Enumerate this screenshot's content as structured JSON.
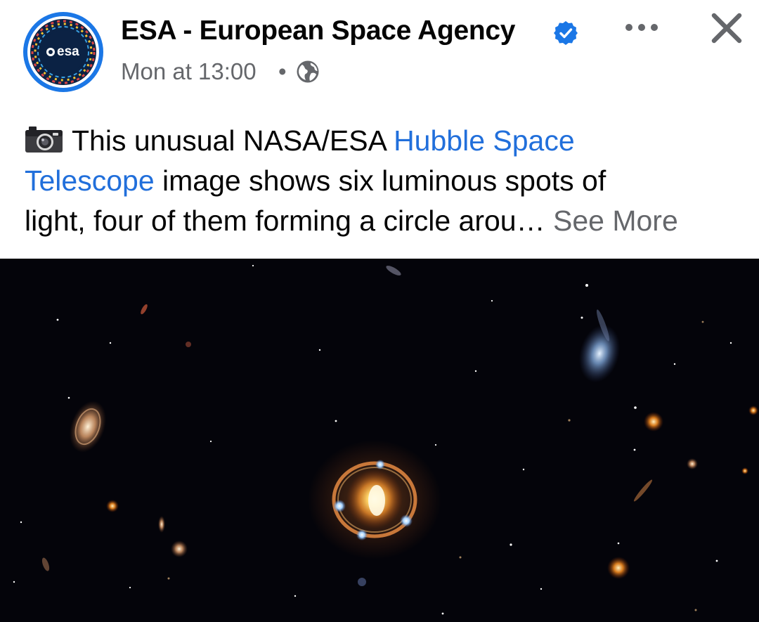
{
  "header": {
    "page_name": "ESA - European Space Agency",
    "avatar_text": "esa",
    "timestamp": "Mon at 13:00",
    "separator": "•",
    "privacy_icon": "globe-icon",
    "verified_icon": "verified-badge-icon",
    "more_icon": "more-horizontal-icon",
    "close_icon": "close-icon"
  },
  "caption": {
    "emoji": "camera-icon",
    "line1_text": "This unusual NASA/ESA ",
    "line1_link": "Hubble Space",
    "line2_link": "Telescope",
    "line2_text": " image shows six luminous spots of",
    "line3_text": "light, four of them forming a circle arou…",
    "see_more": "See More"
  },
  "photo": {
    "subject": "hubble-einstein-ring-image"
  },
  "colors": {
    "text_primary": "#050505",
    "text_secondary": "#65676b",
    "link": "#216fdb",
    "verified_blue": "#1b77e6",
    "photo_background": "#04040a"
  }
}
